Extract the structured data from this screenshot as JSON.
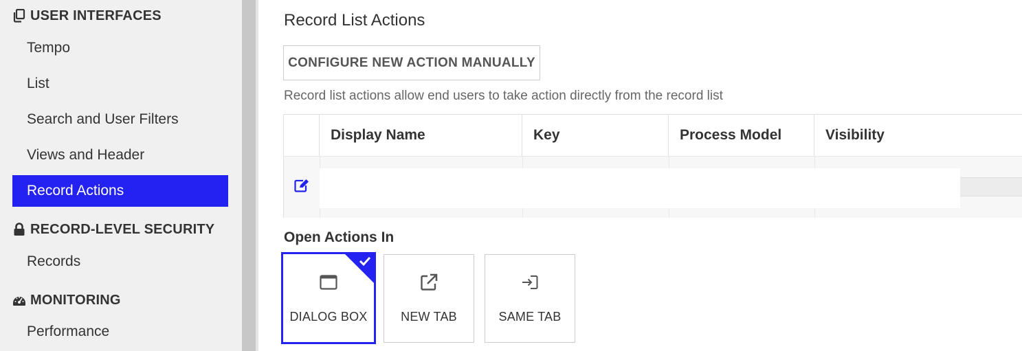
{
  "sidebar": {
    "sections": [
      {
        "title": "USER INTERFACES",
        "icon": "copy-icon",
        "items": [
          {
            "label": "Tempo"
          },
          {
            "label": "List"
          },
          {
            "label": "Search and User Filters"
          },
          {
            "label": "Views and Header"
          },
          {
            "label": "Record Actions",
            "active": true
          }
        ]
      },
      {
        "title": "RECORD-LEVEL SECURITY",
        "icon": "lock-icon",
        "items": [
          {
            "label": "Records"
          }
        ]
      },
      {
        "title": "MONITORING",
        "icon": "dashboard-icon",
        "items": [
          {
            "label": "Performance"
          }
        ]
      }
    ]
  },
  "main": {
    "title": "Record List Actions",
    "configure_button": "CONFIGURE NEW ACTION MANUALLY",
    "description": "Record list actions allow end users to take action directly from the record list",
    "table": {
      "columns": [
        "Display Name",
        "Key",
        "Process Model",
        "Visibility"
      ],
      "rows": [
        {
          "edit_icon": "edit-icon",
          "display_name": "",
          "key": "",
          "process_model": "",
          "visibility": ""
        }
      ]
    },
    "open_actions": {
      "label": "Open Actions In",
      "options": [
        {
          "label": "DIALOG BOX",
          "icon": "window-icon",
          "selected": true
        },
        {
          "label": "NEW TAB",
          "icon": "external-link-icon",
          "selected": false
        },
        {
          "label": "SAME TAB",
          "icon": "sign-in-icon",
          "selected": false
        }
      ]
    }
  },
  "colors": {
    "accent": "#2322f0",
    "sidebar_bg": "#f0f0f0",
    "divider": "#c7c7c7"
  }
}
